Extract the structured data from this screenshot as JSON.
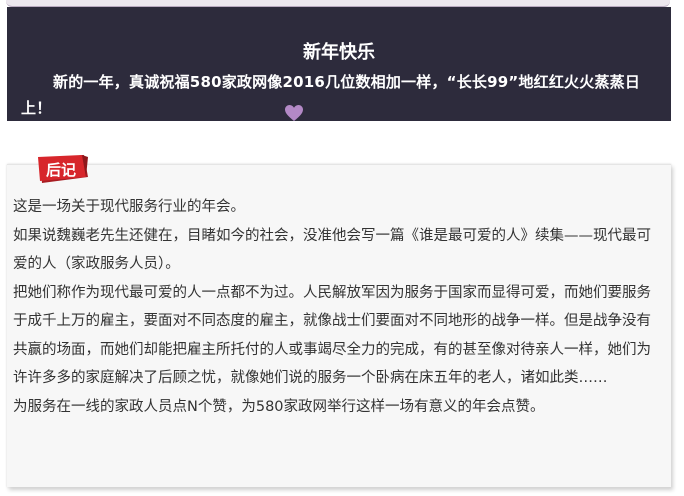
{
  "banner": {
    "title": "新年快乐",
    "text": "新的一年，真诚祝福580家政网像2016几位数相加一样，“长长99”地红红火火蒸蒸日上！"
  },
  "card": {
    "tag_label": "后记",
    "paragraphs": [
      "这是一场关于现代服务行业的年会。",
      "如果说魏巍老先生还健在，目睹如今的社会，没准他会写一篇《谁是最可爱的人》续集——现代最可爱的人（家政服务人员）。",
      "把她们称作为现代最可爱的人一点都不为过。人民解放军因为服务于国家而显得可爱，而她们要服务于成千上万的雇主，要面对不同态度的雇主，就像战士们要面对不同地形的战争一样。但是战争没有共赢的场面，而她们却能把雇主所托付的人或事竭尽全力的完成，有的甚至像对待亲人一样，她们为许许多多的家庭解决了后顾之忧，就像她们说的服务一个卧病在床五年的老人，诸如此类……",
      "为服务在一线的家政人员点N个赞，为580家政网举行这样一场有意义的年会点赞。"
    ]
  },
  "colors": {
    "banner_bg": "#2d2b3c",
    "tag_red": "#d7262b",
    "heart": "#b389c6",
    "text": "#333333"
  }
}
